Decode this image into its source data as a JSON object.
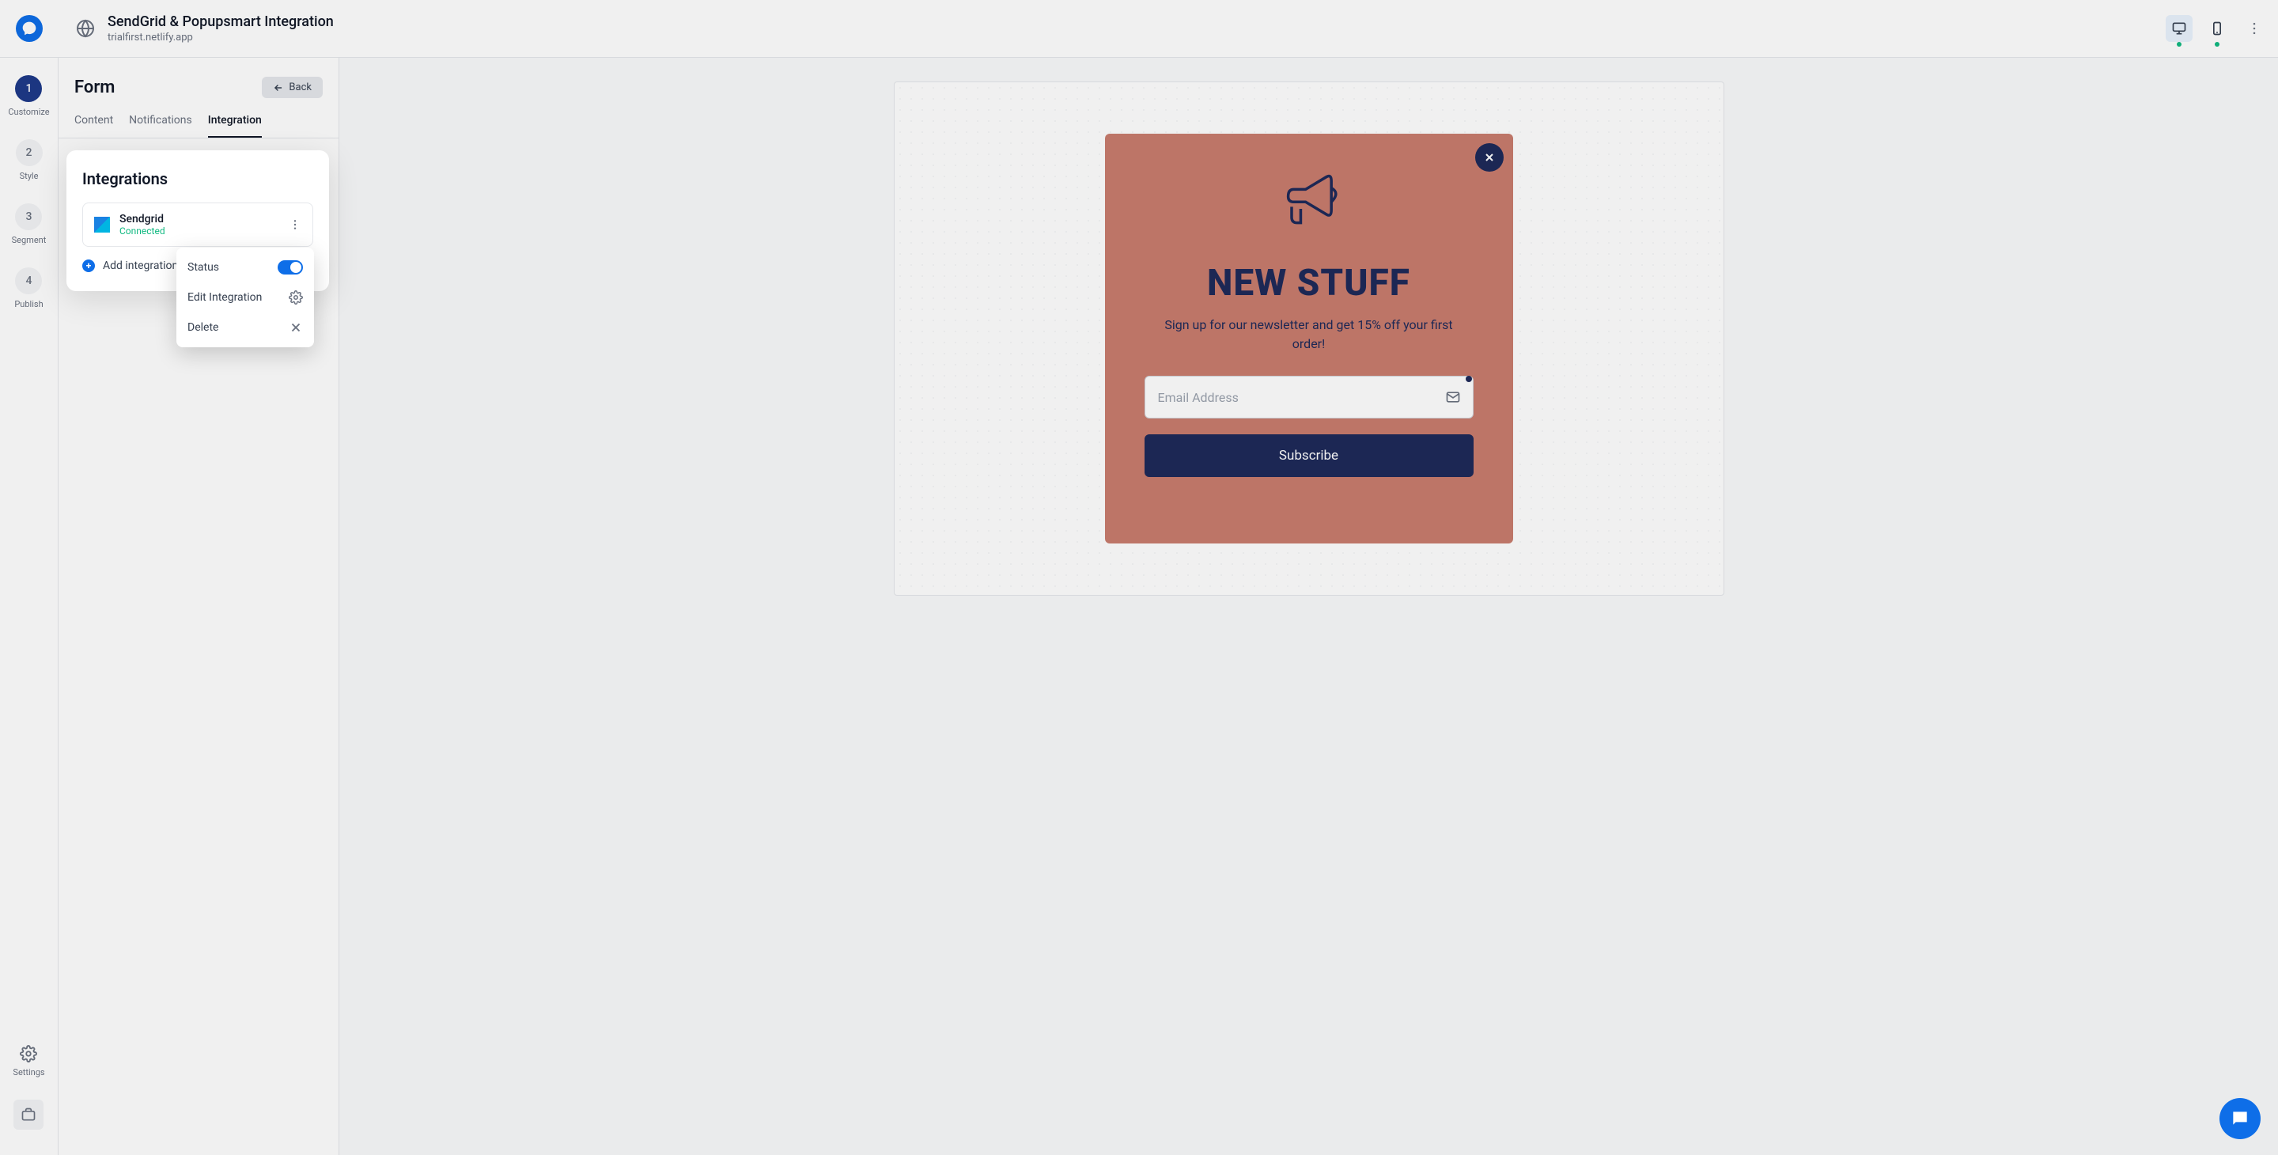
{
  "header": {
    "title": "SendGrid & Popupsmart Integration",
    "subtitle": "trialfirst.netlify.app"
  },
  "sidebar": {
    "steps": [
      {
        "num": "1",
        "label": "Customize"
      },
      {
        "num": "2",
        "label": "Style"
      },
      {
        "num": "3",
        "label": "Segment"
      },
      {
        "num": "4",
        "label": "Publish"
      }
    ],
    "settings_label": "Settings"
  },
  "panel": {
    "title": "Form",
    "back_label": "Back",
    "tabs": [
      {
        "label": "Content"
      },
      {
        "label": "Notifications"
      },
      {
        "label": "Integration"
      }
    ]
  },
  "integrations": {
    "title": "Integrations",
    "item": {
      "name": "Sendgrid",
      "status": "Connected"
    },
    "add_label": "Add integration",
    "menu": {
      "status": "Status",
      "edit": "Edit Integration",
      "delete": "Delete"
    }
  },
  "popup": {
    "heading": "NEW STUFF",
    "sub": "Sign up for our newsletter and get 15% off your first order!",
    "placeholder": "Email Address",
    "button": "Subscribe"
  }
}
